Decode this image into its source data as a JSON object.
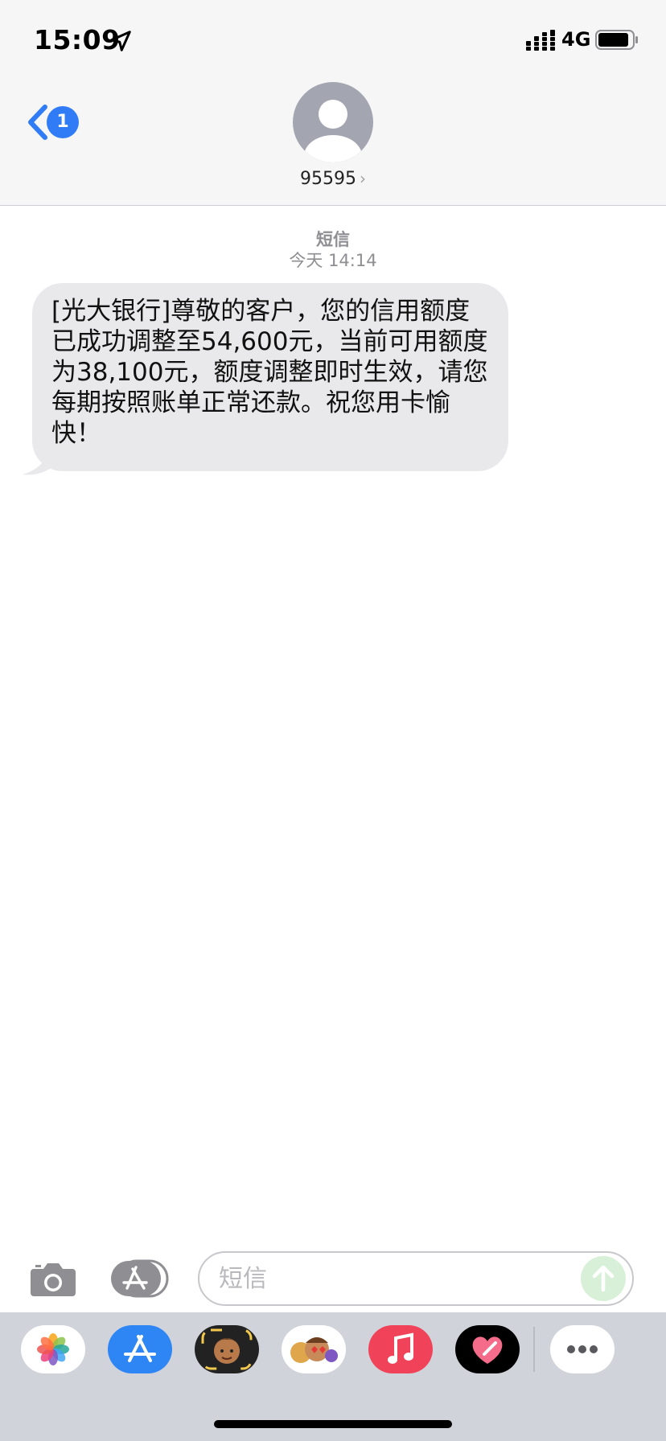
{
  "status_bar": {
    "time": "15:09",
    "network": "4G",
    "icons": [
      "location-arrow-icon",
      "signal-icon",
      "battery-icon"
    ]
  },
  "nav": {
    "back_badge_count": "1",
    "contact_name": "95595",
    "contact_chevron": "›"
  },
  "thread": {
    "service_label": "短信",
    "timestamp": "今天 14:14",
    "messages": [
      {
        "direction": "incoming",
        "text": "[光大银行]尊敬的客户，您的信用额度已成功调整至54,600元，当前可用额度为38,100元，额度调整即时生效，请您每期按照账单正常还款。祝您用卡愉快！"
      }
    ]
  },
  "composer": {
    "placeholder": "短信",
    "value": "",
    "icons": [
      "camera-icon",
      "app-store-icon",
      "send-arrow-icon"
    ]
  },
  "app_drawer": {
    "apps": [
      "photos-app-icon",
      "app-store-app-icon",
      "memoji-app-icon",
      "animoji-stickers-app-icon",
      "music-app-icon",
      "digital-touch-app-icon",
      "more-apps-icon"
    ]
  },
  "colors": {
    "accent": "#2f7cf6",
    "bubble_incoming": "#e9e9eb",
    "header_bg": "#f6f6f6",
    "drawer_bg": "#d1d3da",
    "send_disabled": "#d8f0d8"
  }
}
